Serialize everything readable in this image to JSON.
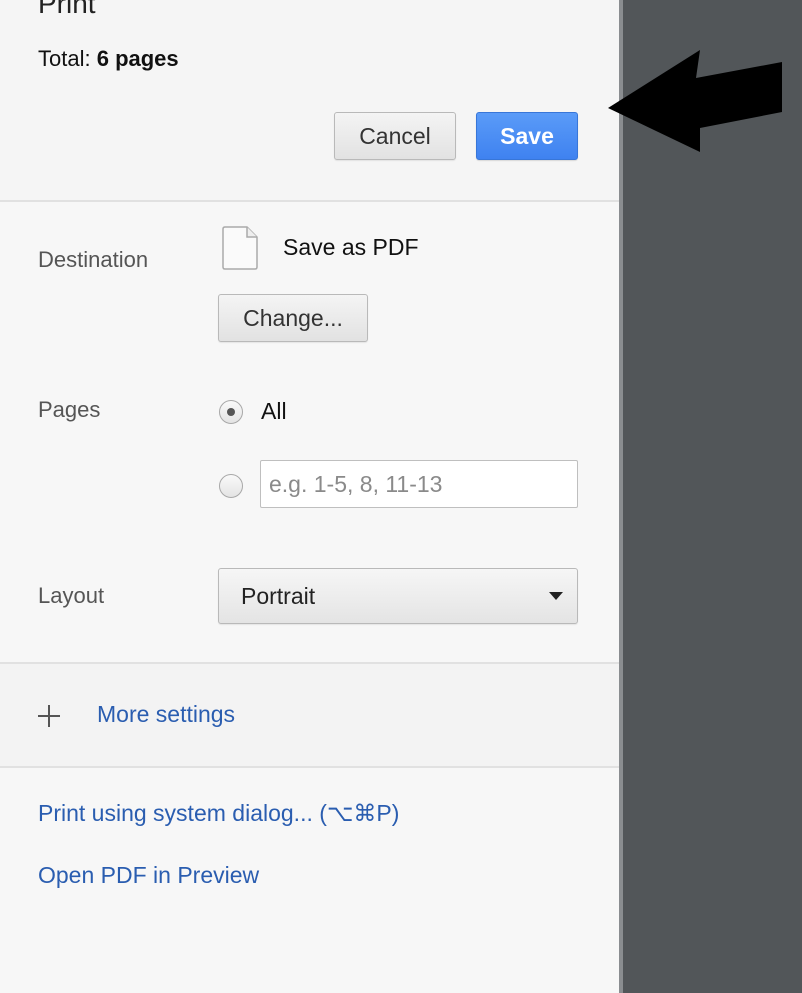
{
  "header": {
    "title": "Print",
    "total_label": "Total:",
    "total_value": "6 pages",
    "cancel_label": "Cancel",
    "save_label": "Save"
  },
  "destination": {
    "label": "Destination",
    "name": "Save as PDF",
    "icon": "document-icon",
    "change_label": "Change..."
  },
  "pages": {
    "label": "Pages",
    "options": [
      {
        "label": "All",
        "selected": true
      },
      {
        "label": "",
        "selected": false
      }
    ],
    "range_placeholder": "e.g. 1-5, 8, 11-13"
  },
  "layout": {
    "label": "Layout",
    "selected": "Portrait"
  },
  "more_settings": {
    "label": "More settings",
    "icon": "plus-icon"
  },
  "links": {
    "system_dialog": "Print using system dialog... (⌥⌘P)",
    "open_preview": "Open PDF in Preview"
  },
  "colors": {
    "accent_blue": "#4a8df5",
    "link_blue": "#2a5db0",
    "preview_bg": "#525659"
  }
}
